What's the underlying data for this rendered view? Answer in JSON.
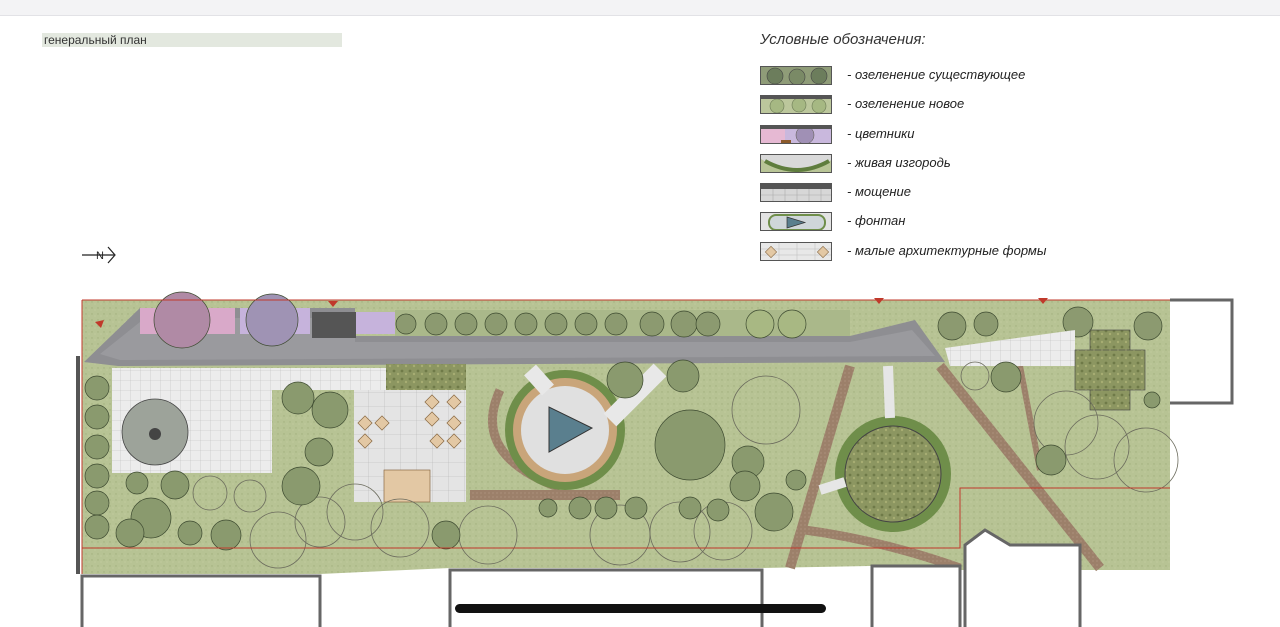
{
  "document": {
    "plan_label": "генеральный план",
    "north_label": "N"
  },
  "legend": {
    "title": "Условные обозначения:",
    "items": [
      {
        "label": "- озеленение существующее",
        "swatch": "existing-greenery"
      },
      {
        "label": "- озеленение новое",
        "swatch": "new-greenery"
      },
      {
        "label": "- цветники",
        "swatch": "flowerbeds"
      },
      {
        "label": "- живая изгородь",
        "swatch": "hedge"
      },
      {
        "label": "- мощение",
        "swatch": "paving"
      },
      {
        "label": "- фонтан",
        "swatch": "fountain"
      },
      {
        "label": "- малые архитектурные формы",
        "swatch": "small-forms"
      }
    ]
  },
  "colors": {
    "lawn": "#b9c597",
    "paving": "#8f8f91",
    "paving_light": "#e6e6e6",
    "path": "#9a7d66",
    "hedge": "#6f8e4a",
    "flowers": "#d9a9c9",
    "water": "#7a9eb0",
    "boundary": "#c0392b",
    "building_outline": "#777777"
  }
}
